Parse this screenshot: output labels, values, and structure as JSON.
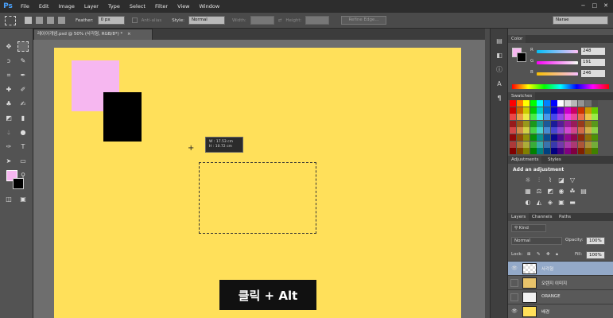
{
  "app": {
    "logo": "Ps"
  },
  "menu": [
    "File",
    "Edit",
    "Image",
    "Layer",
    "Type",
    "Select",
    "Filter",
    "View",
    "Window"
  ],
  "window_controls": [
    "−",
    "□",
    "✕"
  ],
  "options": {
    "feather_label": "Feather:",
    "feather_value": "0 px",
    "antialias_label": "Anti-alias",
    "style_label": "Style:",
    "style_value": "Normal",
    "width_label": "Width:",
    "height_label": "Height:",
    "refine_label": "Refine Edge...",
    "workspace_value": "Narae"
  },
  "document": {
    "tab_title": "레이어개념.psd @ 50% (사각형, RGB/8*) *",
    "tooltip_w": "W :   17.53 cm",
    "tooltip_h": "H :   10.72 cm",
    "caption": "클릭 + Alt"
  },
  "colors": {
    "foreground": "#f6b7f0",
    "background": "#000000",
    "canvas": "#ffe05a",
    "accent": "#4aa3ff"
  },
  "color_panel": {
    "tab": "Color",
    "r_label": "R",
    "r_value": "248",
    "g_label": "G",
    "g_value": "191",
    "b_label": "B",
    "b_value": "246"
  },
  "swatches_panel": {
    "tab": "Swatches"
  },
  "adjustments_panel": {
    "tabs": [
      "Adjustments",
      "Styles"
    ],
    "title": "Add an adjustment"
  },
  "layers_panel": {
    "tabs": [
      "Layers",
      "Channels",
      "Paths"
    ],
    "kind_label": "Kind",
    "blend_mode": "Normal",
    "opacity_label": "Opacity:",
    "opacity_value": "100%",
    "lock_label": "Lock:",
    "fill_label": "Fill:",
    "fill_value": "100%",
    "layers": [
      {
        "name": "사각형",
        "visible": true,
        "selected": true
      },
      {
        "name": "오렌지 이미지",
        "visible": false,
        "selected": false
      },
      {
        "name": "ORANGE",
        "visible": false,
        "selected": false
      },
      {
        "name": "배경",
        "visible": true,
        "selected": false
      }
    ]
  }
}
